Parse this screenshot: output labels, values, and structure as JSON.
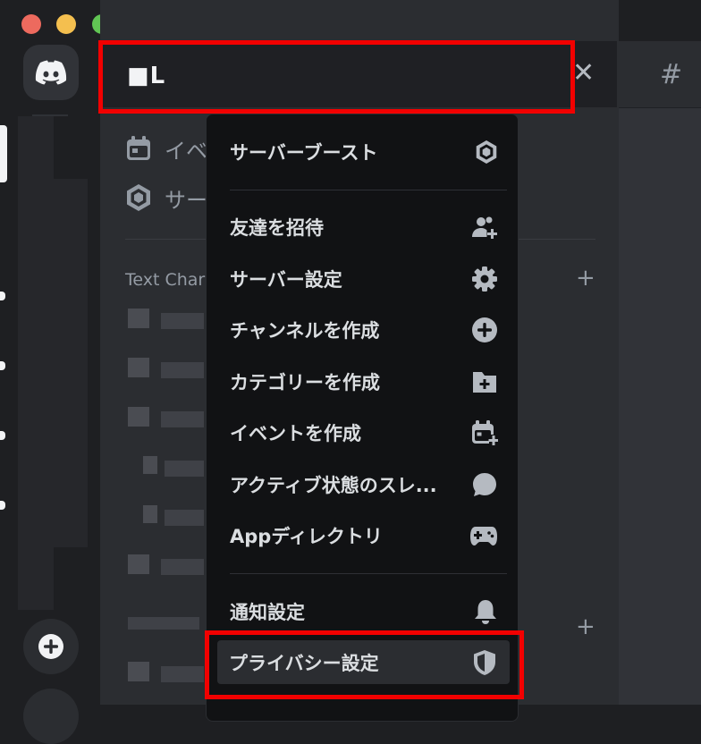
{
  "window": {
    "traffic_lights": [
      "close",
      "minimize",
      "zoom"
    ]
  },
  "server": {
    "name": "■L"
  },
  "header": {
    "close_glyph": "✕",
    "channel_icon": "#"
  },
  "sidebar": {
    "items": [
      {
        "label": "イベ",
        "icon": "calendar-icon"
      },
      {
        "label": "サー",
        "icon": "boost-gem-icon"
      }
    ],
    "category": {
      "label": "Text Char",
      "add_glyph": "+"
    },
    "second_category_add": "+"
  },
  "menu": {
    "items": [
      {
        "label": "サーバーブースト",
        "icon": "boost-gem-icon"
      },
      {
        "label": "友達を招待",
        "icon": "invite-friend-icon"
      },
      {
        "label": "サーバー設定",
        "icon": "gear-icon"
      },
      {
        "label": "チャンネルを作成",
        "icon": "plus-circle-icon"
      },
      {
        "label": "カテゴリーを作成",
        "icon": "folder-plus-icon"
      },
      {
        "label": "イベントを作成",
        "icon": "calendar-plus-icon"
      },
      {
        "label": "アクティブ状態のスレ...",
        "icon": "speech-bubble-icon"
      },
      {
        "label": "Appディレクトリ",
        "icon": "gamepad-icon"
      },
      {
        "label": "通知設定",
        "icon": "bell-icon"
      },
      {
        "label": "プライバシー設定",
        "icon": "shield-icon"
      }
    ]
  },
  "rail": {
    "add_glyph": "+"
  },
  "colors": {
    "highlight": "#f20000",
    "menu_bg": "#111214",
    "sidebar_bg": "#2b2d31"
  }
}
